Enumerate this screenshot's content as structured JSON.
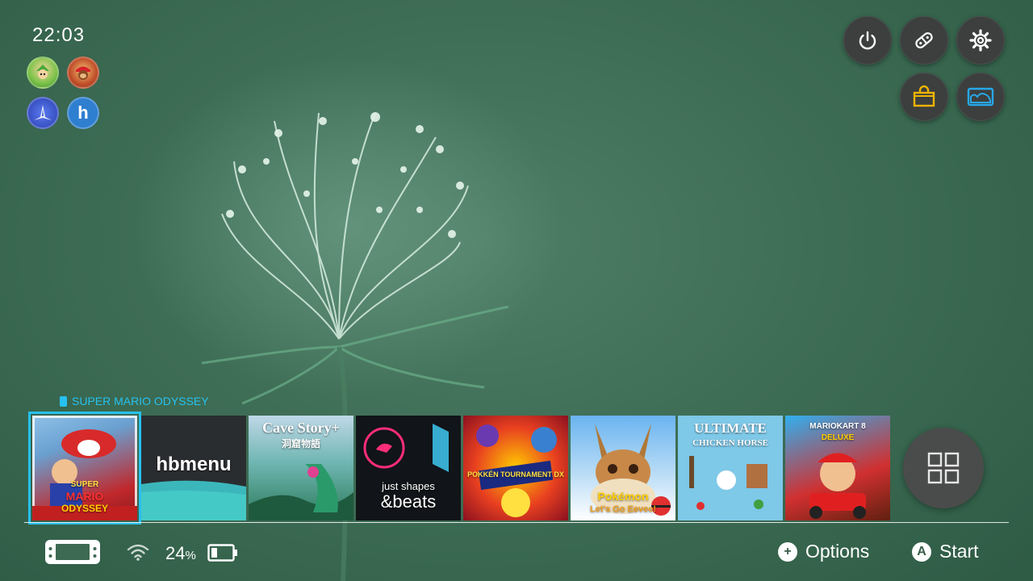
{
  "status": {
    "time": "22:03",
    "battery_percent": "24",
    "battery_unit": "%"
  },
  "users": [
    {
      "name": "link-avatar",
      "icon": "link-character"
    },
    {
      "name": "diddy-avatar",
      "icon": "diddy-kong-character"
    },
    {
      "name": "arwing-avatar",
      "icon": "arwing-ship"
    },
    {
      "name": "homebrew-avatar",
      "icon": "h-letter",
      "label": "h"
    }
  ],
  "system_buttons": [
    {
      "name": "power-button",
      "icon": "power-icon"
    },
    {
      "name": "controllers-button",
      "icon": "joycon-icon"
    },
    {
      "name": "settings-button",
      "icon": "gear-icon"
    },
    {
      "name": "eshop-button",
      "icon": "shopping-bag-icon",
      "color": "#f0b400"
    },
    {
      "name": "album-button",
      "icon": "album-icon",
      "color": "#27a8e8"
    }
  ],
  "selected_game": {
    "title": "SUPER MARIO ODYSSEY"
  },
  "games": [
    {
      "name": "super-mario-odyssey",
      "lines": [
        "SUPER",
        "MARIO",
        "ODYSSEY"
      ]
    },
    {
      "name": "hbmenu",
      "label": "hbmenu"
    },
    {
      "name": "cave-story",
      "label": "Cave Story+",
      "sub": "洞窟物語"
    },
    {
      "name": "just-shapes-beats",
      "label_top": "just shapes",
      "label_bottom": "&beats"
    },
    {
      "name": "pokken-tournament-dx",
      "label": "POKKÉN TOURNAMENT DX"
    },
    {
      "name": "pokemon-lets-go-eevee",
      "label": "Pokémon",
      "sub": "Let's Go Eevee!"
    },
    {
      "name": "ultimate-chicken-horse",
      "label": "ULTIMATE",
      "sub": "CHICKEN HORSE"
    },
    {
      "name": "mario-kart-8-deluxe",
      "label": "MARIOKART 8",
      "sub": "DELUXE"
    }
  ],
  "hints": {
    "options": "Options",
    "start": "Start",
    "options_key": "+",
    "start_key": "A"
  },
  "colors": {
    "accent": "#27c1f0"
  }
}
